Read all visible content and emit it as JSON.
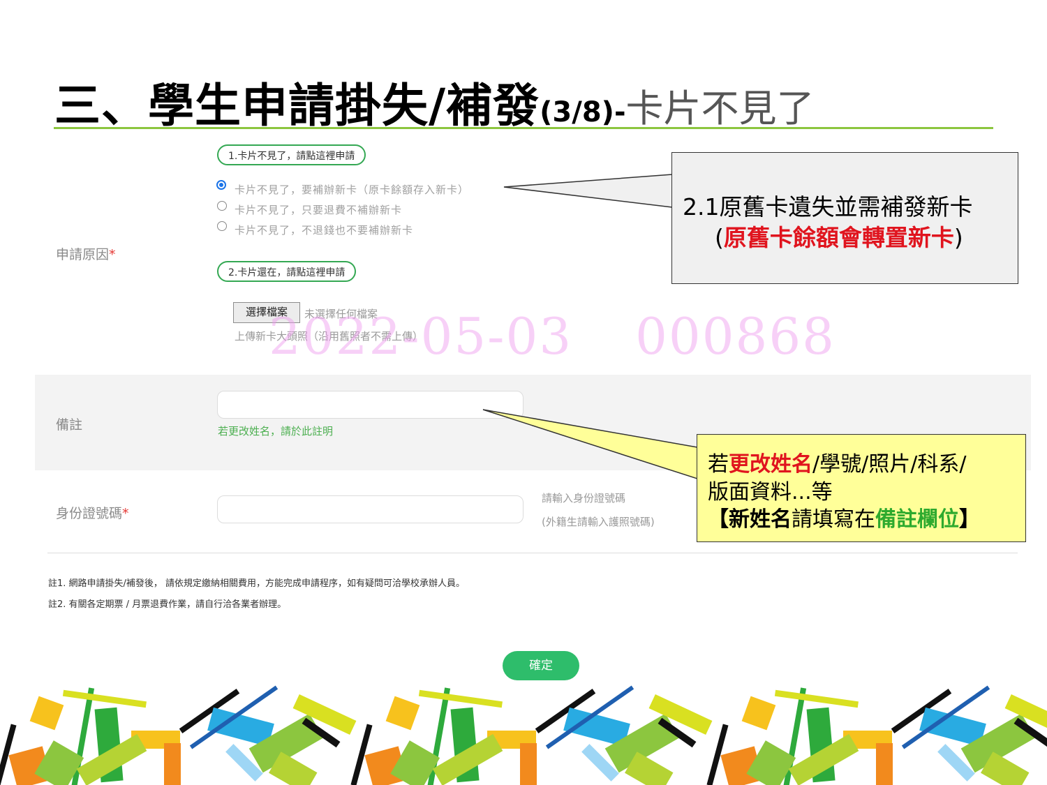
{
  "slide": {
    "title_main": "三、學生申請掛失/補發",
    "title_num": "(3/8)-",
    "title_sub": "卡片不見了"
  },
  "form": {
    "reason_label": "申請原因",
    "required_mark": "*",
    "lost_card_button": "1.卡片不見了，請點這裡申請",
    "options": [
      "卡片不見了，要補辦新卡（原卡餘額存入新卡）",
      "卡片不見了，只要退費不補辦新卡",
      "卡片不見了，不退錢也不要補辦新卡"
    ],
    "have_card_button": "2.卡片還在，請點這裡申請",
    "file_button": "選擇檔案",
    "file_status": "未選擇任何檔案",
    "photo_hint": "上傳新卡大頭照（沿用舊照者不需上傳）",
    "remarks_label": "備註",
    "remarks_value": "",
    "remarks_hint": "若更改姓名，請於此註明",
    "id_label": "身份證號碼",
    "id_value": "",
    "id_hint_1": "請輸入身份證號碼",
    "id_hint_2": "(外籍生請輸入護照號碼)",
    "note_1": "註1. 網路申請掛失/補發後， 請依規定繳納相關費用，方能完成申請程序，如有疑問可洽學校承辦人員。",
    "note_2": "註2. 有關各定期票 / 月票退費作業，請自行洽各業者辦理。",
    "confirm_button": "確定",
    "watermark_date": "2022-05-03",
    "watermark_id": "000868"
  },
  "callout1": {
    "line1": "2.1原舊卡遺失並需補發新卡",
    "line2_open": "(",
    "line2_red": "原舊卡餘額會轉置新卡",
    "line2_close": ")"
  },
  "callout2": {
    "l1_pre": "若",
    "l1_red": "更改姓名",
    "l1_post": "/學號/照片/科系/",
    "l2": "版面資料...等",
    "l3_open": "【",
    "l3_bold": "新姓名",
    "l3_mid": "請填寫在",
    "l3_green": "備註欄位",
    "l3_close": "】"
  },
  "colors": {
    "accent_green": "#8cc63f",
    "button_green": "#2ebd6b",
    "highlight_red": "#e0141e",
    "callout_yellow": "#ffff99"
  }
}
